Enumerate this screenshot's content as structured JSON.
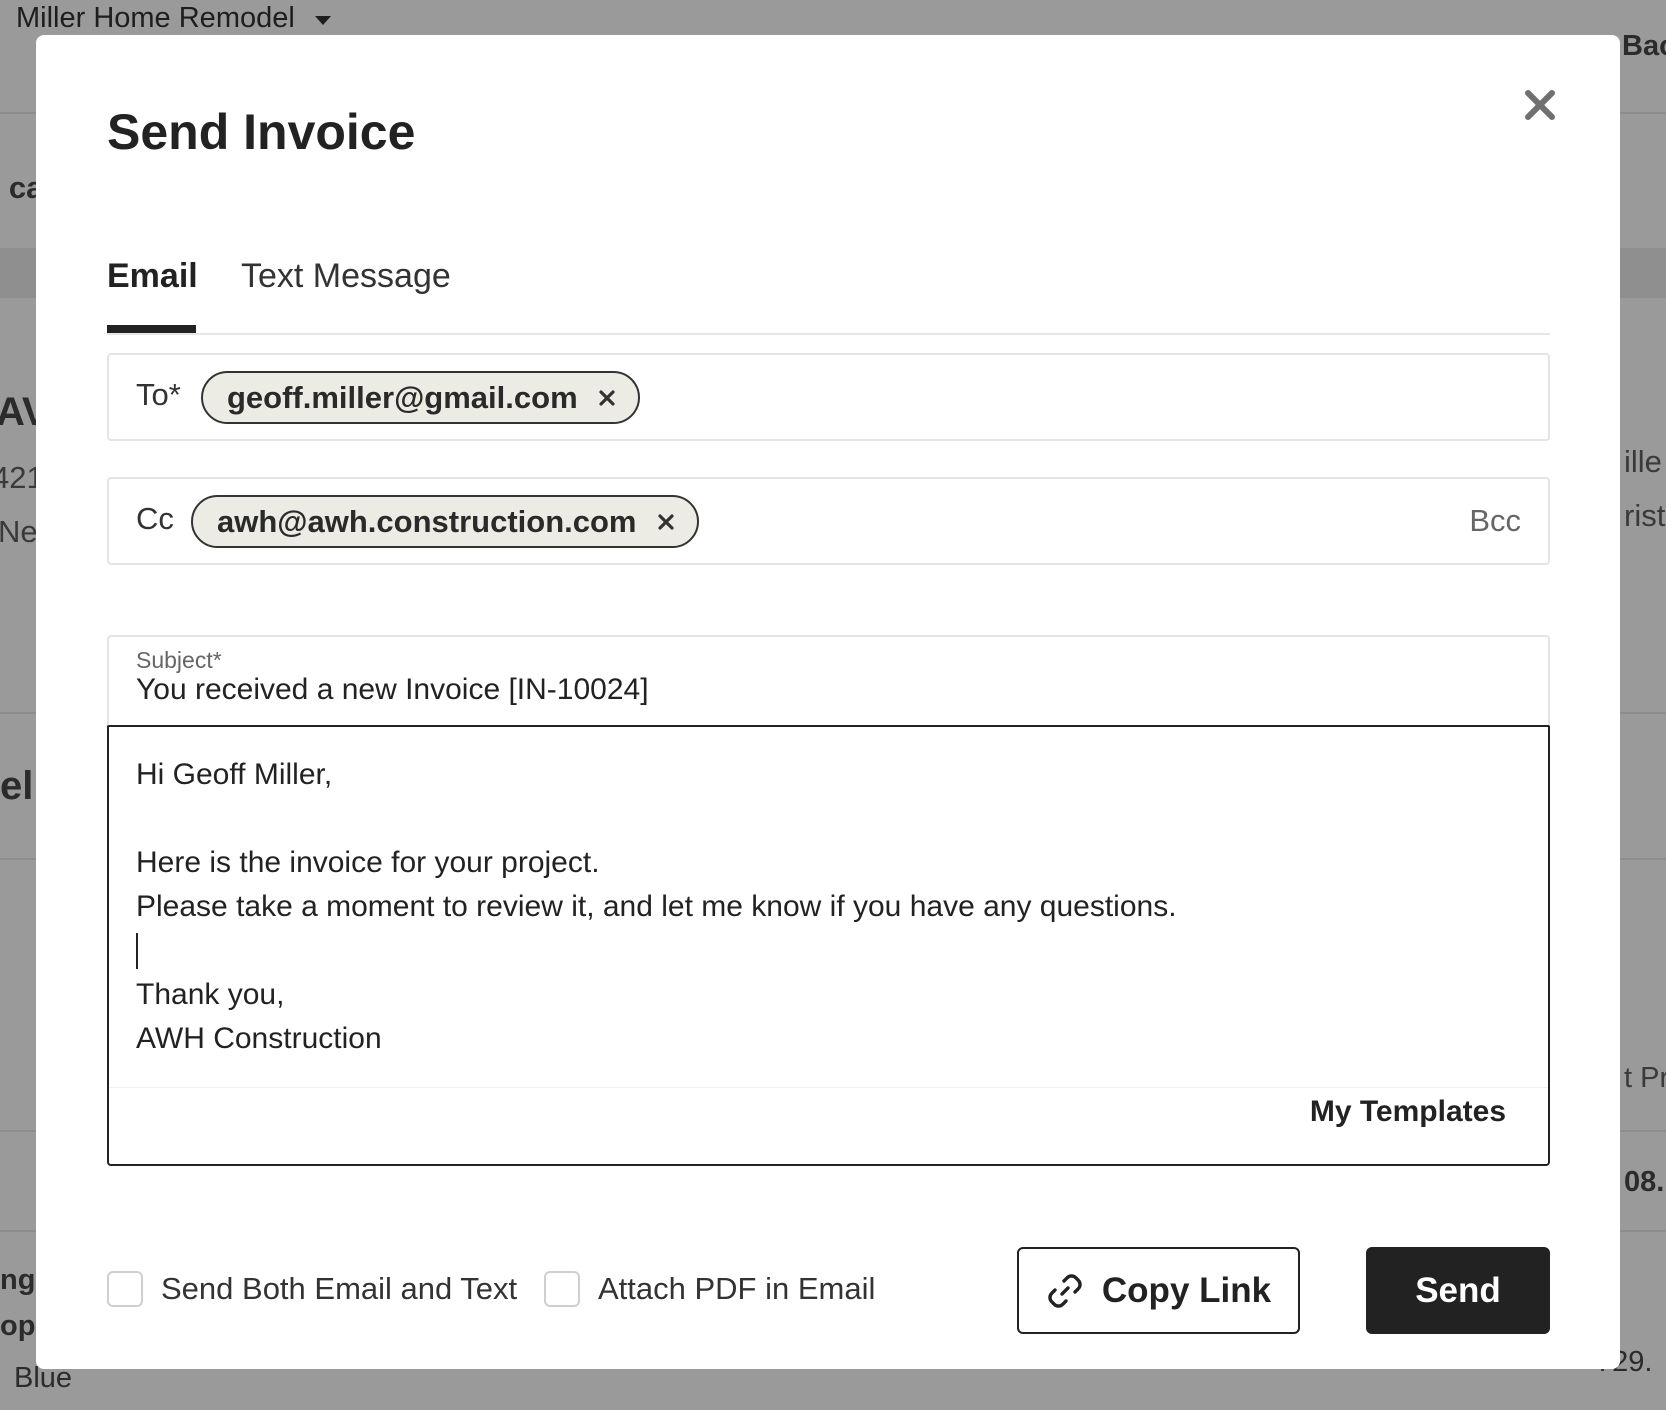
{
  "background": {
    "project_name": "Miller Home Remodel",
    "fragments": {
      "top_right": "Bac",
      "left_1": ": ca",
      "left_2": "AV",
      "left_3": "421",
      "left_4": "Ne",
      "left_5": "el",
      "left_6": "ng",
      "left_7": "op",
      "left_8": "Blue",
      "right_1": "ille",
      "right_2": "rist",
      "right_3": "t Pr",
      "right_4": "08.",
      "right_5": "729."
    }
  },
  "modal": {
    "title": "Send Invoice",
    "tabs": [
      {
        "label": "Email",
        "active": true
      },
      {
        "label": "Text Message",
        "active": false
      }
    ],
    "to": {
      "label": "To*",
      "recipients": [
        "geoff.miller@gmail.com"
      ]
    },
    "cc": {
      "label": "Cc",
      "recipients": [
        "awh@awh.construction.com"
      ],
      "bcc_label": "Bcc"
    },
    "subject": {
      "label": "Subject*",
      "value": "You received a new Invoice [IN-10024]"
    },
    "body": {
      "lines": [
        "Hi Geoff Miller,",
        "",
        "Here is the invoice for your project.",
        "Please take a moment to review it, and let me know if you have any questions.",
        "",
        "Thank you,",
        "AWH Construction"
      ],
      "templates_label": "My Templates"
    },
    "footer": {
      "send_both_label": "Send Both Email and Text",
      "attach_pdf_label": "Attach PDF in Email",
      "copy_link_label": "Copy Link",
      "send_label": "Send"
    }
  }
}
